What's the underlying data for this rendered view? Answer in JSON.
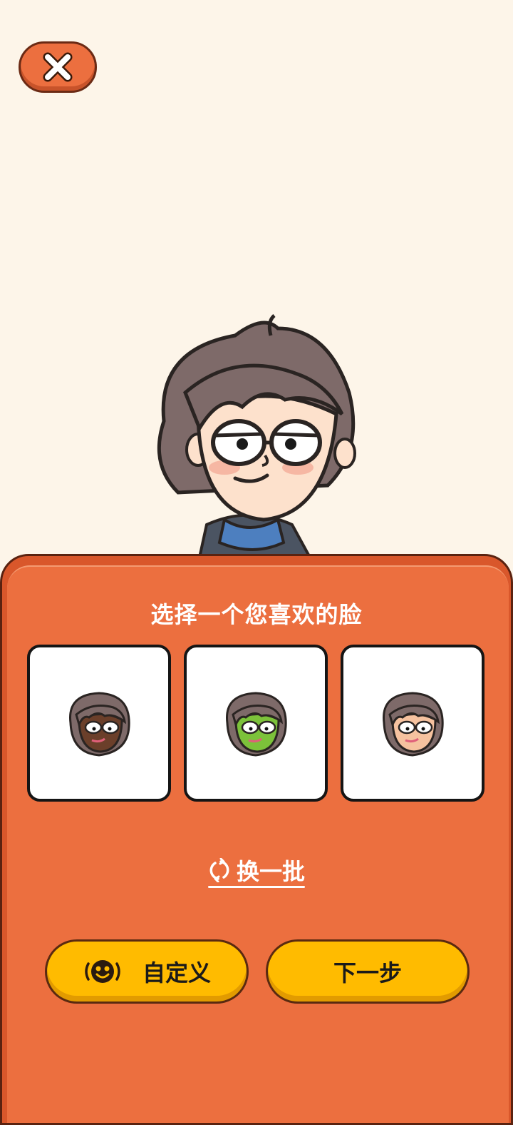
{
  "header": {
    "close_icon": "close-x-icon"
  },
  "preview": {
    "avatar_icon": "avatar-preview"
  },
  "sheet": {
    "title": "选择一个您喜欢的脸",
    "faces": [
      {
        "skin": "#6b3f2a",
        "icon": "face-dark-skin"
      },
      {
        "skin": "#7cc23a",
        "icon": "face-green-skin"
      },
      {
        "skin": "#f6c29f",
        "icon": "face-light-skin"
      }
    ],
    "refresh_label": "换一批",
    "custom_label": "自定义",
    "next_label": "下一步"
  },
  "colors": {
    "background": "#fdf5e9",
    "sheet": "#ec6f3f",
    "button": "#ffbb00"
  }
}
